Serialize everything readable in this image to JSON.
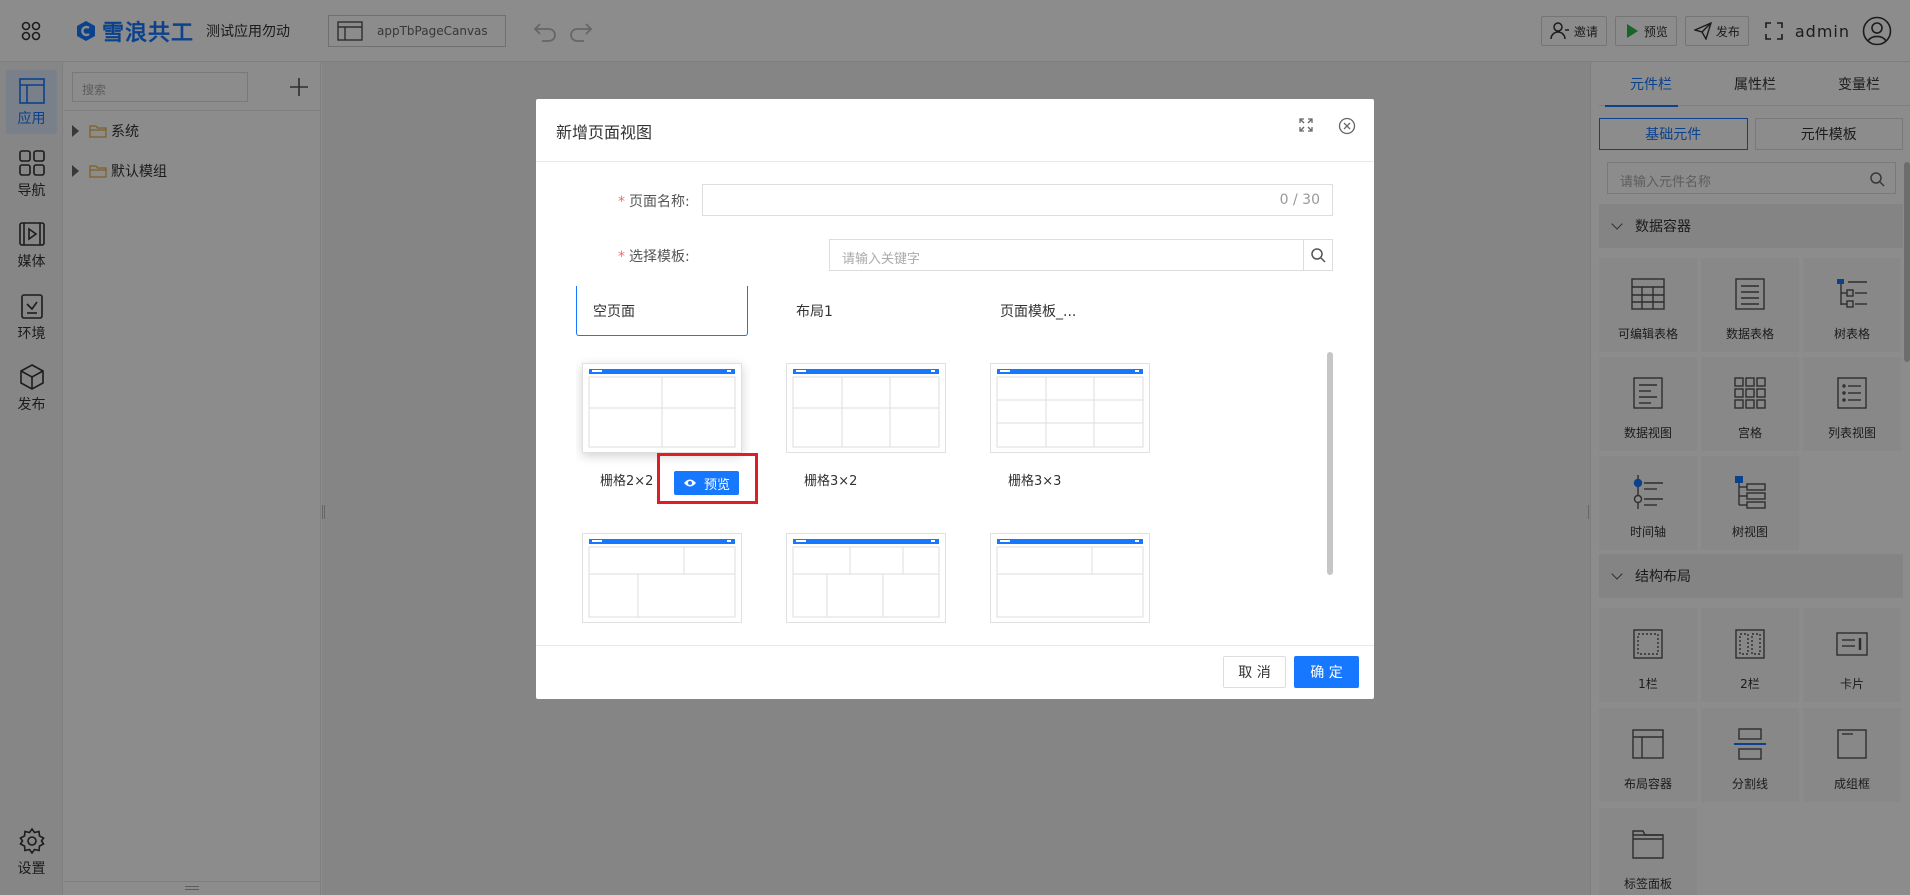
{
  "topbar": {
    "logo_text": "雪浪共工",
    "app_name": "测试应用勿动",
    "page_select": "appTbPageCanvas",
    "invite": "邀请",
    "preview": "预览",
    "publish": "发布",
    "user": "admin"
  },
  "leftnav": {
    "items": [
      {
        "label": "应用",
        "icon": "layout-icon"
      },
      {
        "label": "导航",
        "icon": "grid-icon"
      },
      {
        "label": "媒体",
        "icon": "film-icon"
      },
      {
        "label": "环境",
        "icon": "clipboard-check-icon"
      },
      {
        "label": "发布",
        "icon": "cube-icon"
      }
    ],
    "settings": "设置"
  },
  "tree": {
    "search_placeholder": "搜索",
    "nodes": [
      "系统",
      "默认模组"
    ]
  },
  "rpanel": {
    "tabs": [
      "元件栏",
      "属性栏",
      "变量栏"
    ],
    "subtabs": [
      "基础元件",
      "元件模板"
    ],
    "search_placeholder": "请输入元件名称",
    "groups": [
      {
        "title": "数据容器",
        "items": [
          "可编辑表格",
          "数据表格",
          "树表格",
          "数据视图",
          "宫格",
          "列表视图",
          "时间轴",
          "树视图"
        ]
      },
      {
        "title": "结构布局",
        "items": [
          "1栏",
          "2栏",
          "卡片",
          "布局容器",
          "分割线",
          "成组框",
          "标签面板"
        ]
      }
    ]
  },
  "modal": {
    "title": "新增页面视图",
    "page_name_label": "页面名称:",
    "page_name_counter": "0 / 30",
    "template_label": "选择模板:",
    "keyword_placeholder": "请输入关键字",
    "template_tabs": [
      "空页面",
      "布局1",
      "页面模板_..."
    ],
    "templates": [
      "栅格2×2",
      "栅格3×2",
      "栅格3×3"
    ],
    "preview_button": "预览",
    "cancel": "取 消",
    "confirm": "确 定"
  },
  "colors": {
    "accent": "#1677ff",
    "highlight": "#e21c25",
    "logo_folder": "#e8b04a"
  }
}
